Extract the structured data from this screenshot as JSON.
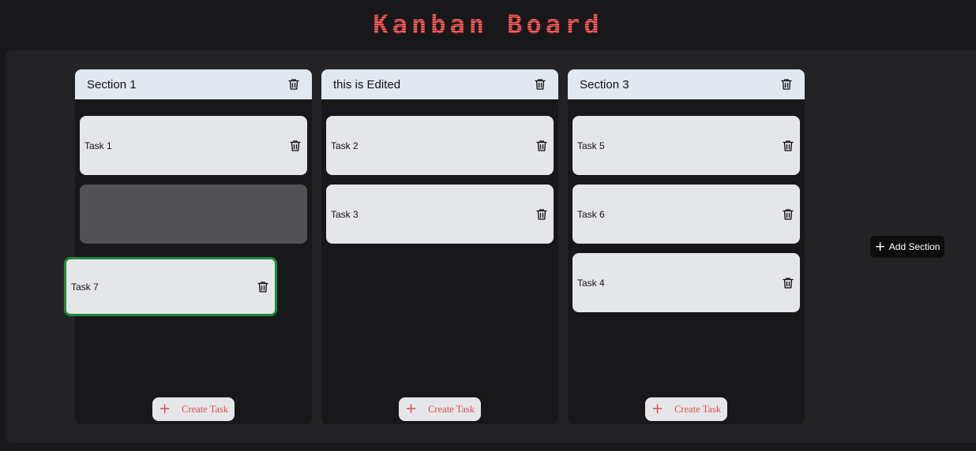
{
  "app": {
    "title": "Kanban Board"
  },
  "sections": [
    {
      "title": "Section 1",
      "tasks": [
        "Task 1"
      ],
      "create_label": "Create Task"
    },
    {
      "title": "this is Edited",
      "tasks": [
        "Task 2",
        "Task 3"
      ],
      "create_label": "Create Task"
    },
    {
      "title": "Section 3",
      "tasks": [
        "Task 5",
        "Task 6",
        "Task 4"
      ],
      "create_label": "Create Task"
    }
  ],
  "dragging_task": {
    "label": "Task 7"
  },
  "add_section": {
    "label": "Add Section"
  },
  "icons": {
    "delete": "trash-icon",
    "add": "plus-icon"
  },
  "colors": {
    "accent": "#e14b4b",
    "drag_border": "#1e8a3e",
    "header_bg": "#e2e8f0"
  }
}
